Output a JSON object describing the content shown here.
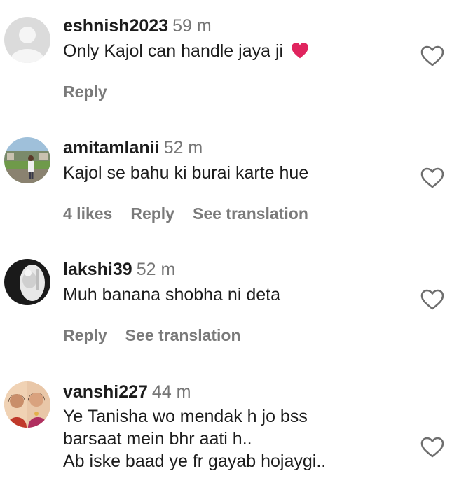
{
  "comments": [
    {
      "username": "eshnish2023",
      "time": "59 m",
      "text": "Only Kajol can handle jaya ji",
      "emoji": "red-heart",
      "actions": {
        "reply": "Reply"
      }
    },
    {
      "username": "amitamlanii",
      "time": "52 m",
      "text": "Kajol se bahu ki burai karte hue",
      "actions": {
        "likes": "4 likes",
        "reply": "Reply",
        "translate": "See translation"
      }
    },
    {
      "username": "lakshi39",
      "time": "52 m",
      "text": "Muh banana shobha ni deta",
      "actions": {
        "reply": "Reply",
        "translate": "See translation"
      }
    },
    {
      "username": "vanshi227",
      "time": "44 m",
      "text_lines": [
        "Ye Tanisha wo mendak h jo bss",
        "barsaat mein bhr aati h..",
        "Ab iske baad ye fr gayab hojaygi.."
      ]
    }
  ],
  "icons": {
    "like": "heart-outline-icon",
    "avatar_default": "default-avatar-icon"
  },
  "colors": {
    "text": "#1c1c1c",
    "muted": "#757575",
    "heart_red": "#e0245e"
  }
}
